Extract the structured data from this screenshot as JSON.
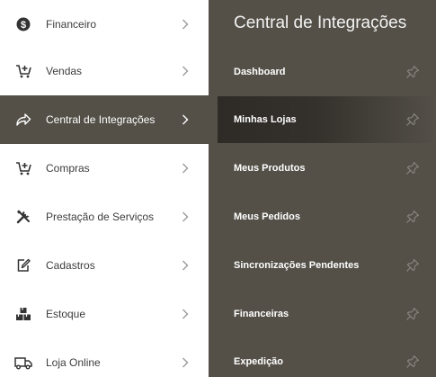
{
  "left_menu": {
    "items": [
      {
        "label": "Financeiro",
        "icon": "dollar-circle-icon",
        "active": false
      },
      {
        "label": "Vendas",
        "icon": "cart-plus-icon",
        "active": false
      },
      {
        "label": "Central de Integrações",
        "icon": "share-arrow-icon",
        "active": true
      },
      {
        "label": "Compras",
        "icon": "cart-plus-icon",
        "active": false
      },
      {
        "label": "Prestação de Serviços",
        "icon": "tools-icon",
        "active": false
      },
      {
        "label": "Cadastros",
        "icon": "edit-document-icon",
        "active": false
      },
      {
        "label": "Estoque",
        "icon": "boxes-icon",
        "active": false
      },
      {
        "label": "Loja Online",
        "icon": "delivery-truck-icon",
        "active": false
      }
    ]
  },
  "submenu": {
    "title": "Central de Integrações",
    "items": [
      {
        "label": "Dashboard",
        "active": false
      },
      {
        "label": "Minhas Lojas",
        "active": true
      },
      {
        "label": "Meus Produtos",
        "active": false
      },
      {
        "label": "Meus Pedidos",
        "active": false
      },
      {
        "label": "Sincronizações Pendentes",
        "active": false
      },
      {
        "label": "Financeiras",
        "active": false
      },
      {
        "label": "Expedição",
        "active": false
      }
    ]
  },
  "colors": {
    "panel_bg": "#545048",
    "active_item_dark": "#2e2b27",
    "menu_text": "#3d3d3d",
    "icon_color": "#333333"
  }
}
